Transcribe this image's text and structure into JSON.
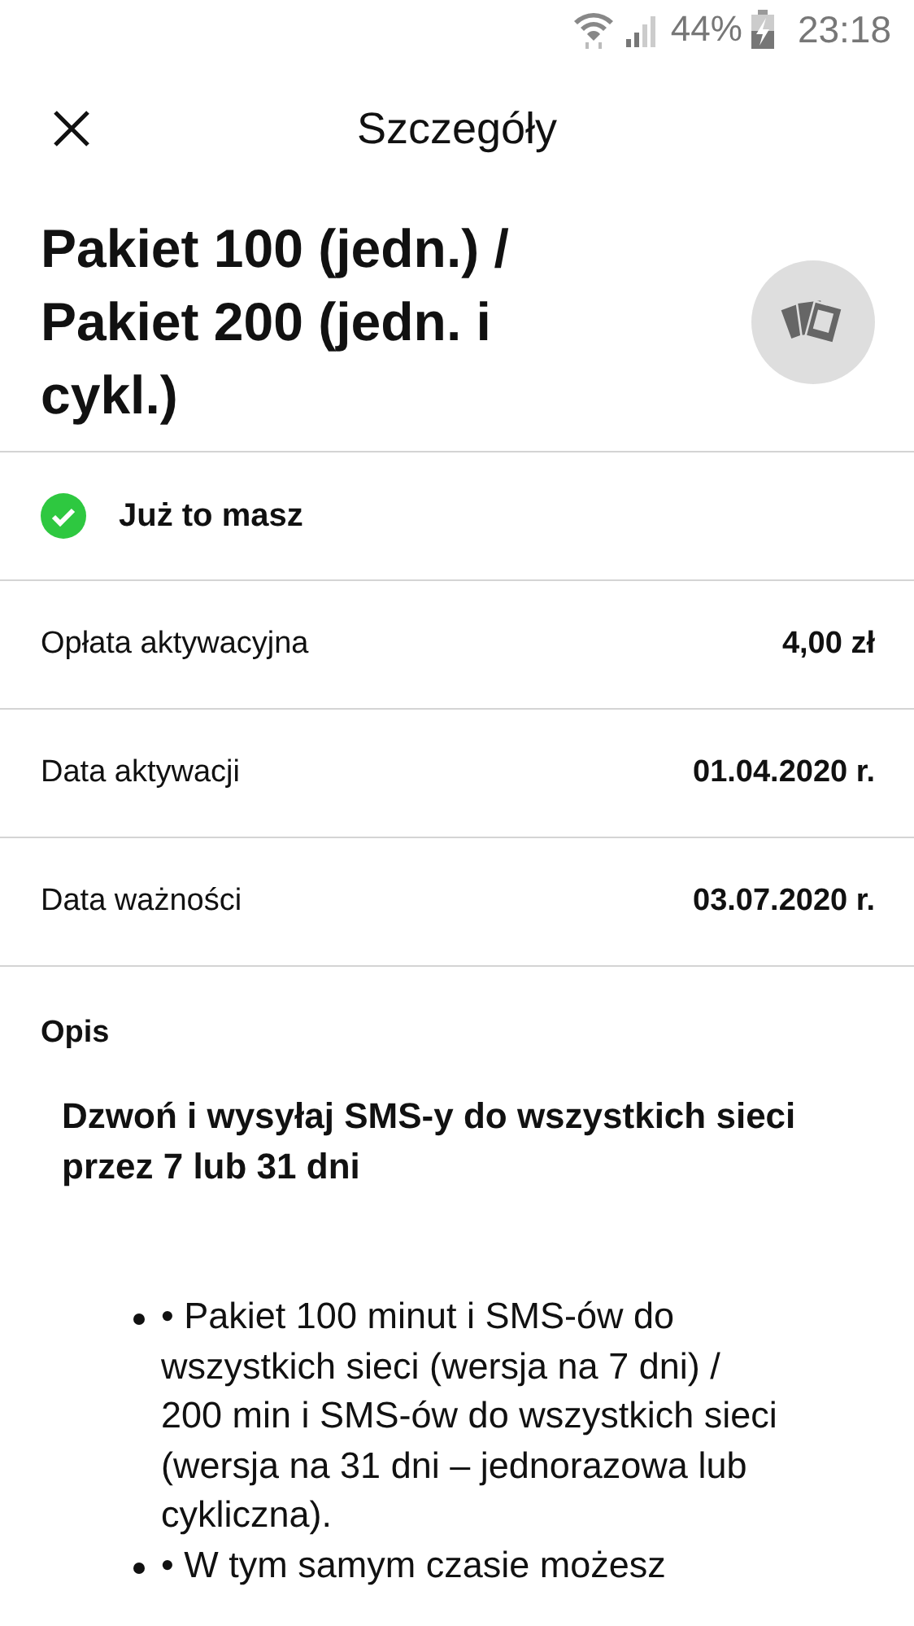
{
  "status_bar": {
    "battery": "44%",
    "time": "23:18"
  },
  "header": {
    "title": "Szczegóły"
  },
  "package": {
    "name": "Pakiet 100 (jedn.) / Pakiet 200 (jedn. i cykl.)"
  },
  "ownership": {
    "label": "Już to masz"
  },
  "details": [
    {
      "label": "Opłata aktywacyjna",
      "value": "4,00 zł"
    },
    {
      "label": "Data aktywacji",
      "value": "01.04.2020 r."
    },
    {
      "label": "Data ważności",
      "value": "03.07.2020 r."
    }
  ],
  "description": {
    "heading": "Opis",
    "lead": "Dzwoń i wysyłaj SMS-y do wszystkich sieci przez 7 lub 31 dni",
    "items": [
      "• Pakiet 100 minut i SMS-ów do wszystkich sieci (wersja na 7 dni) / 200 min i SMS-ów do wszystkich sieci (wersja na 31 dni – jednorazowa lub cykliczna).",
      "• W tym samym czasie możesz"
    ]
  }
}
